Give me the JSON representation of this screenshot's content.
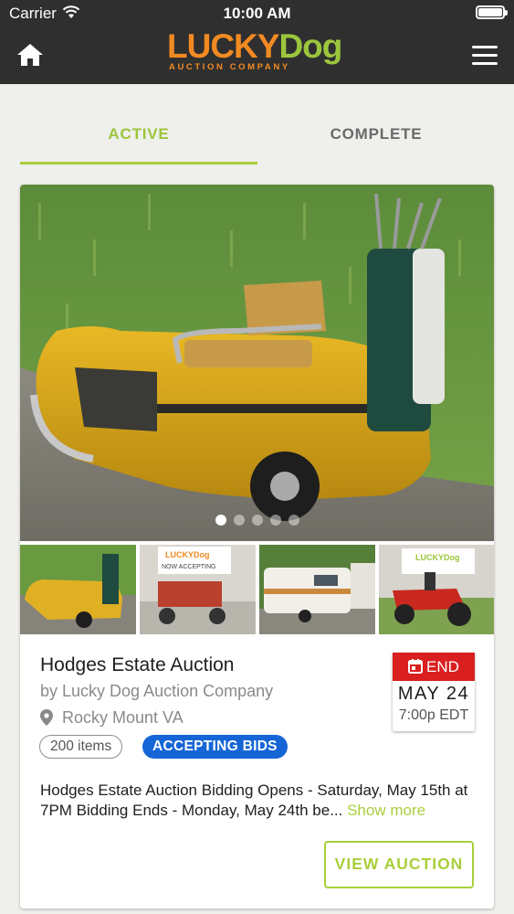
{
  "status_bar": {
    "carrier": "Carrier",
    "time": "10:00 AM"
  },
  "header": {
    "logo": {
      "main_left": "LUCKY",
      "main_right": "Dog",
      "sub": "AUCTION COMPANY"
    },
    "colors": {
      "bar": "#2f2f2f",
      "orange": "#f28a22",
      "green": "#9bc53d"
    }
  },
  "tabs": [
    {
      "label": "ACTIVE",
      "active": true
    },
    {
      "label": "COMPLETE",
      "active": false
    }
  ],
  "auction": {
    "title": "Hodges Estate Auction",
    "byline": "by Lucky Dog Auction Company",
    "location": "Rocky Mount VA",
    "item_count": "200 items",
    "status": "ACCEPTING BIDS",
    "end": {
      "label": "END",
      "date": "MAY 24",
      "time": "7:00p EDT"
    },
    "description": "Hodges Estate Auction Bidding Opens - Saturday, May 15th at 7PM Bidding Ends - Monday, May 24th be...",
    "show_more": "Show more",
    "view_button": "VIEW AUCTION",
    "carousel": {
      "slides": 5,
      "current": 1
    },
    "thumbnails": [
      "yellow-golf-cart-photo",
      "red-generator-photo",
      "camper-trailer-photo",
      "red-lawn-tractor-photo"
    ],
    "thumb_sign_text": "LUCKYDog NOW ACCEPTING"
  }
}
